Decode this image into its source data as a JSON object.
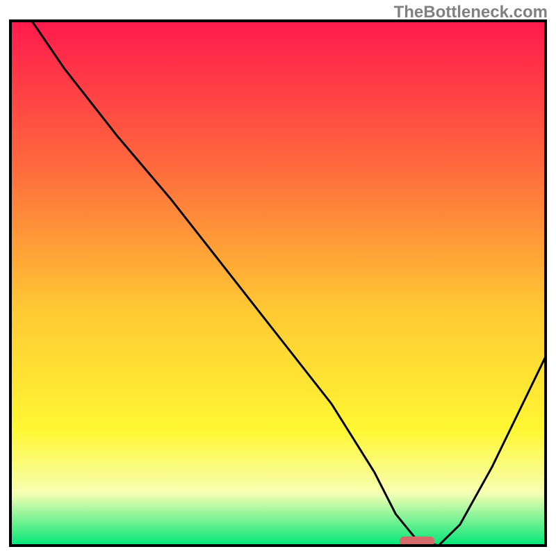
{
  "watermark": "TheBottleneck.com",
  "colors": {
    "gradient_top": "#ff1a4d",
    "gradient_mid_upper": "#ff6a3d",
    "gradient_mid": "#ffc933",
    "gradient_mid_lower": "#fff733",
    "gradient_pale": "#f7ffb3",
    "gradient_bottom": "#00e676",
    "curve": "#000000",
    "frame": "#000000",
    "marker": "#d46a6a"
  },
  "chart_data": {
    "type": "line",
    "title": "",
    "xlabel": "",
    "ylabel": "",
    "xlim": [
      0,
      100
    ],
    "ylim": [
      0,
      100
    ],
    "grid": false,
    "legend": false,
    "series": [
      {
        "name": "bottleneck-curve",
        "x": [
          4,
          10,
          20,
          25,
          30,
          40,
          50,
          60,
          68,
          72,
          76,
          80,
          84,
          90,
          100
        ],
        "y": [
          100,
          91,
          78,
          72,
          66,
          53,
          40,
          27,
          14,
          6,
          1,
          0,
          4,
          15,
          36
        ]
      }
    ],
    "marker": {
      "name": "optimal-region",
      "x": 76,
      "y": 0.8,
      "shape": "pill"
    },
    "annotations": []
  }
}
